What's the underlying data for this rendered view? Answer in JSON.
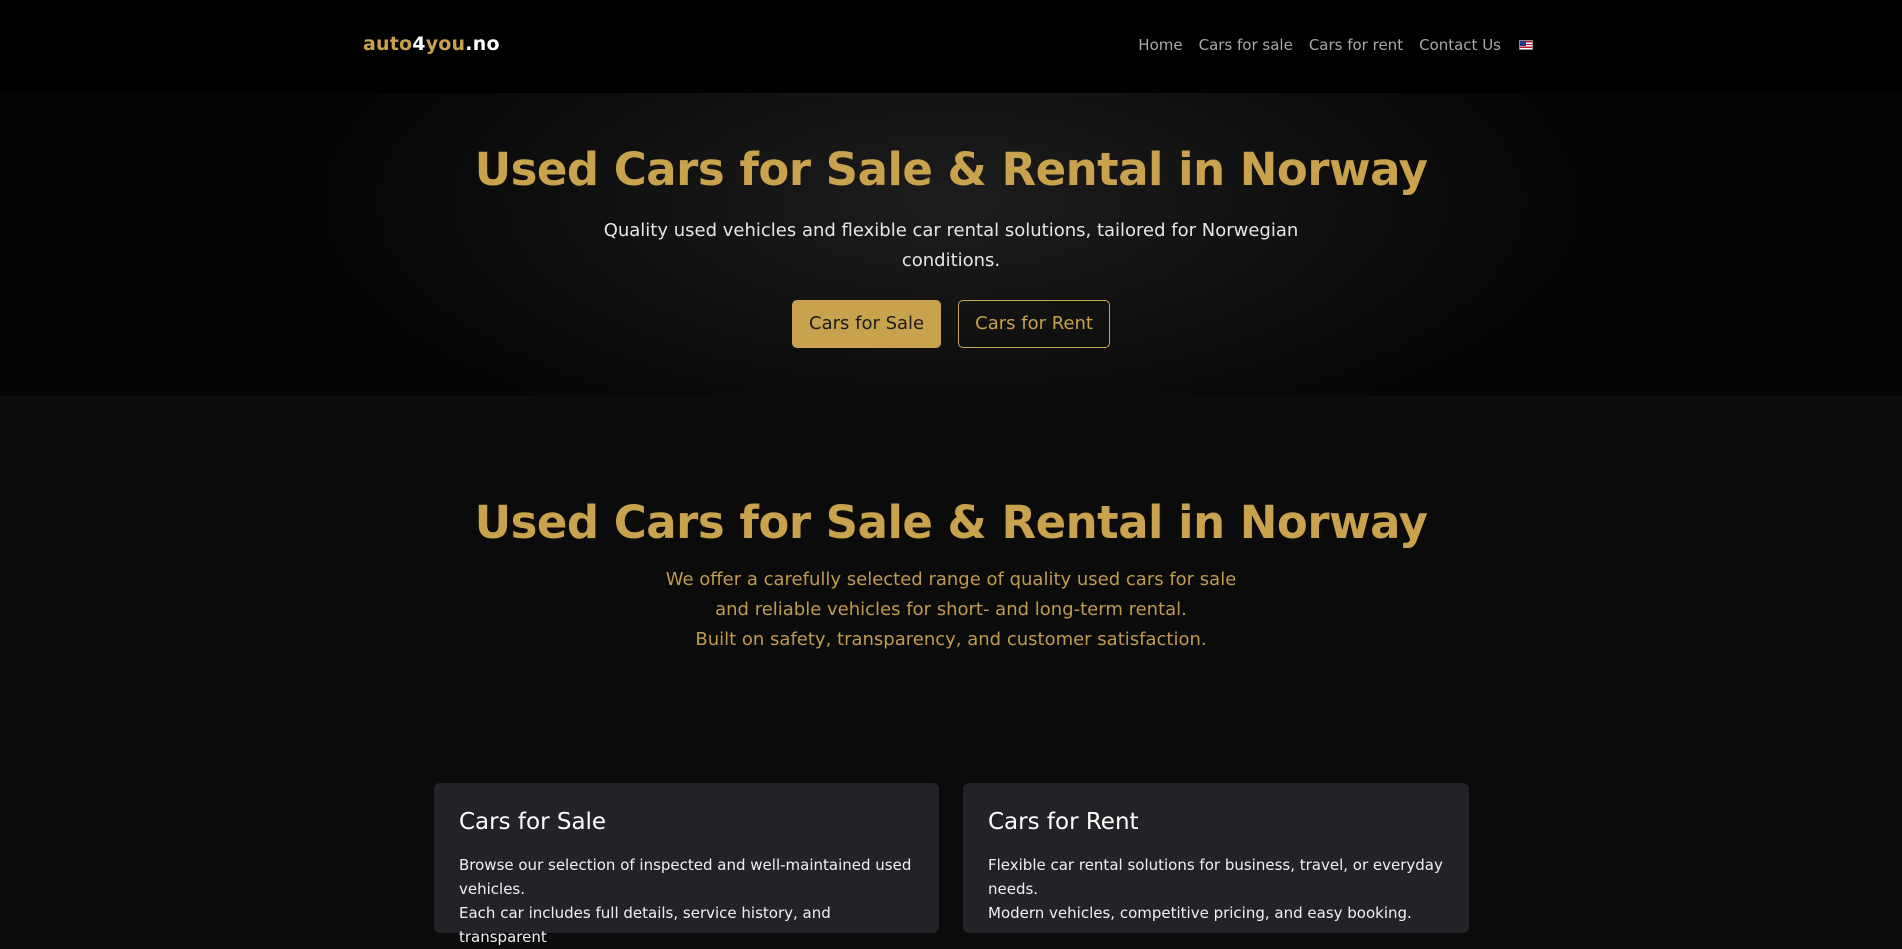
{
  "navbar": {
    "brand": {
      "part1": "auto",
      "part2": "4",
      "part3": "you",
      "part4": ".no"
    },
    "links": [
      "Home",
      "Cars for sale",
      "Cars for rent",
      "Contact Us"
    ],
    "language_icon": "us-flag-icon"
  },
  "hero": {
    "title": "Used Cars for Sale & Rental in Norway",
    "subtitle": "Quality used vehicles and flexible car rental solutions, tailored for Norwegian conditions.",
    "btn_sale": "Cars for Sale",
    "btn_rent": "Cars for Rent"
  },
  "intro": {
    "title": "Used Cars for Sale & Rental in Norway",
    "line1": "We offer a carefully selected range of quality used cars for sale",
    "line2": "and reliable vehicles for short- and long-term rental.",
    "line3": "Built on safety, transparency, and customer satisfaction."
  },
  "cards": {
    "sale": {
      "title": "Cars for Sale",
      "line1": "Browse our selection of inspected and well-maintained used vehicles.",
      "line2": "Each car includes full details, service history, and transparent"
    },
    "rent": {
      "title": "Cars for Rent",
      "line1": "Flexible car rental solutions for business, travel, or everyday needs.",
      "line2": "Modern vehicles, competitive pricing, and easy booking."
    }
  },
  "colors": {
    "accent": "#c9a24d",
    "background": "#0b0b0b",
    "card": "#212327"
  }
}
